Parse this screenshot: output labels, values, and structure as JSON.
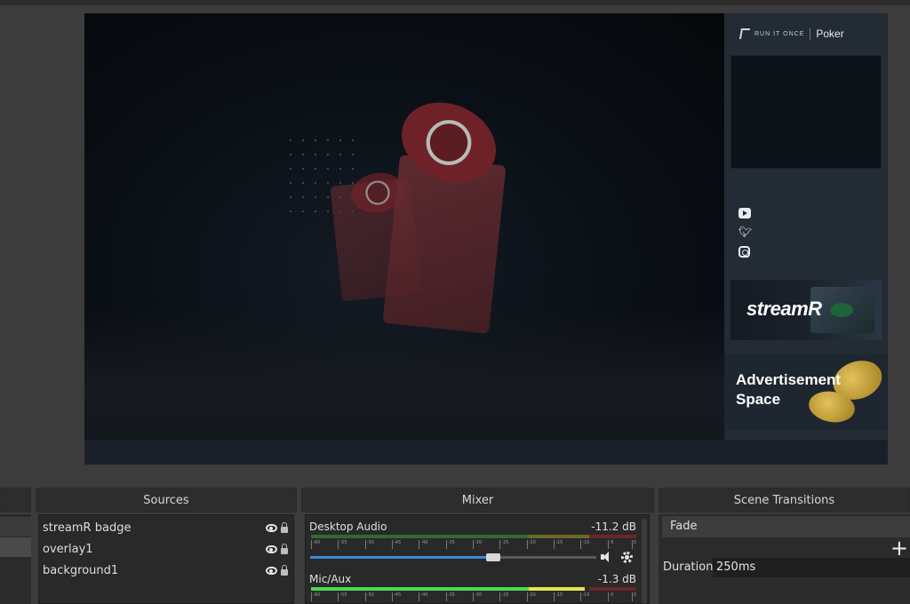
{
  "preview": {
    "sidebar": {
      "brand_small": "RUN IT ONCE",
      "brand_poker": "Poker",
      "streamr_text": "stream",
      "streamr_r": "R",
      "ad_text_line1": "Advertisement",
      "ad_text_line2": "Space"
    }
  },
  "docks": {
    "sources": {
      "title": "Sources",
      "items": [
        {
          "name": "streamR badge"
        },
        {
          "name": "overlay1"
        },
        {
          "name": "background1"
        }
      ]
    },
    "mixer": {
      "title": "Mixer",
      "channels": [
        {
          "label": "Desktop Audio",
          "db": "-11.2 dB",
          "volume_fraction": 0.64
        },
        {
          "label": "Mic/Aux",
          "db": "-1.3 dB"
        }
      ],
      "ticks": [
        "-60",
        "-55",
        "-50",
        "-45",
        "-40",
        "-35",
        "-30",
        "-25",
        "-20",
        "-15",
        "-10",
        "-5",
        "0"
      ]
    },
    "transitions": {
      "title": "Scene Transitions",
      "selected": "Fade",
      "duration_label": "Duration",
      "duration_value": "250ms"
    }
  },
  "colors": {
    "meter_green": "#4cd94c",
    "meter_yellow": "#e6e64c",
    "slider_blue": "#3c8ad6"
  }
}
